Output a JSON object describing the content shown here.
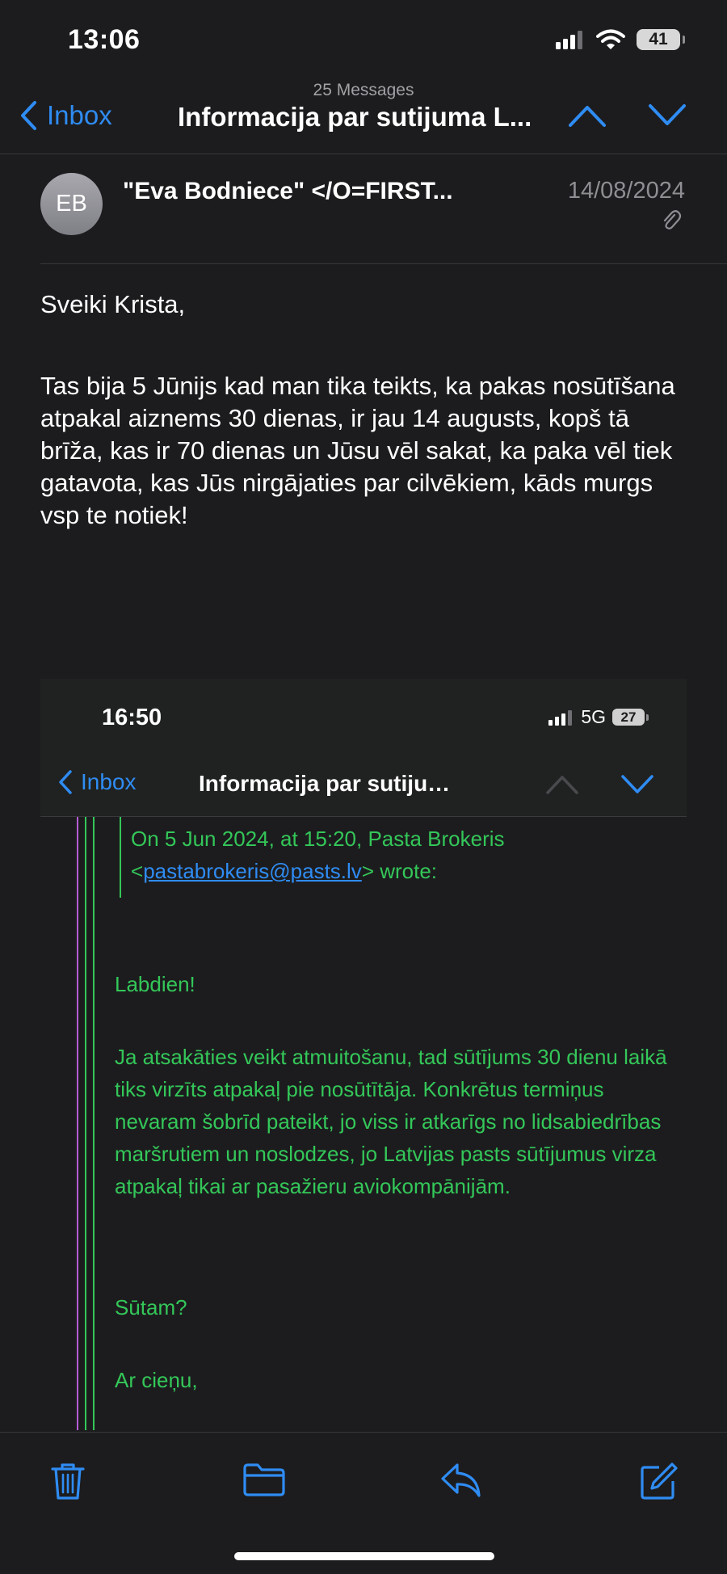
{
  "status_bar": {
    "time": "13:06",
    "battery": "41"
  },
  "nav": {
    "count": "25 Messages",
    "back_label": "Inbox",
    "title": "Informacija par sutijuma L..."
  },
  "header": {
    "avatar_initials": "EB",
    "sender": "\"Eva Bodniece\" </O=FIRST...",
    "date": "14/08/2024"
  },
  "body": {
    "greeting": "Sveiki Krista,",
    "paragraph": "Tas bija 5 Jūnijs kad man tika teikts, ka pakas nosūtīšana atpakal aiznems 30 dienas, ir jau 14 augusts, kopš tā brīža, kas ir 70 dienas un Jūsu vēl sakat, ka paka vēl tiek gatavota, kas Jūs nirgājaties par cilvēkiem, kāds murgs vsp te notiek!"
  },
  "embedded": {
    "status_time": "16:50",
    "network": "5G",
    "battery": "27",
    "back_label": "Inbox",
    "title": "Informacija par sutijuma L...",
    "quote_intro": "On 5 Jun 2024, at 15:20, Pasta Brokeris",
    "quote_email": "pastabrokeris@pasts.lv",
    "quote_lt": "<",
    "quote_wrote": "> wrote:",
    "quote_greeting": "Labdien!",
    "quote_paragraph": "Ja atsakāties veikt atmuitošanu, tad sūtījums 30 dienu laikā tiks virzīts atpakaļ pie nosūtītāja. Konkrētus termiņus nevaram šobrīd pateikt, jo viss ir atkarīgs no lidsabiedrības maršrutiem un noslodzes, jo Latvijas pasts sūtījumus virza atpakaļ tikai ar pasažieru aviokompānijām.",
    "quote_ask": "Sūtam?",
    "quote_signoff": "Ar cieņu,"
  },
  "toolbar": {
    "icons": [
      "trash-icon",
      "folder-icon",
      "reply-icon",
      "compose-icon"
    ]
  },
  "colors": {
    "background": "#1c1c1e",
    "accent": "#2f8cf3",
    "quote_text": "#34c759",
    "quote_bar_purple": "#b65bd6",
    "quote_bar_green": "#34c759"
  }
}
